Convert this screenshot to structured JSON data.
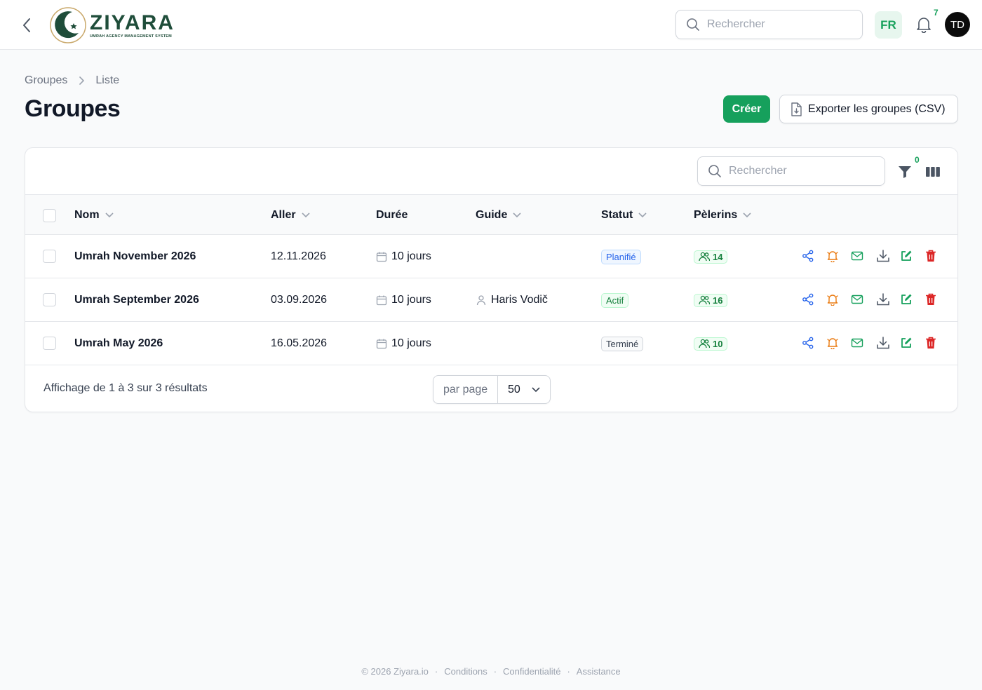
{
  "header": {
    "logo_word": "ZIYARA",
    "logo_tagline": "UMRAH AGENCY MANAGEMENT SYSTEM",
    "search_placeholder": "Rechercher",
    "language": "FR",
    "notifications_count": "7",
    "avatar_initials": "TD"
  },
  "breadcrumb": {
    "items": [
      "Groupes",
      "Liste"
    ]
  },
  "page": {
    "title": "Groupes",
    "create_label": "Créer",
    "export_label": "Exporter les groupes (CSV)"
  },
  "table": {
    "search_placeholder": "Rechercher",
    "filter_count": "0",
    "columns": [
      "Nom",
      "Aller",
      "Durée",
      "Guide",
      "Statut",
      "Pèlerins"
    ],
    "rows": [
      {
        "name": "Umrah November 2026",
        "departure": "12.11.2026",
        "duration": "10 jours",
        "guide": "",
        "status": "Planifié",
        "status_type": "planned",
        "pilgrims": "14"
      },
      {
        "name": "Umrah September 2026",
        "departure": "03.09.2026",
        "duration": "10 jours",
        "guide": "Haris Vodič",
        "status": "Actif",
        "status_type": "active",
        "pilgrims": "16"
      },
      {
        "name": "Umrah May 2026",
        "departure": "16.05.2026",
        "duration": "10 jours",
        "guide": "",
        "status": "Terminé",
        "status_type": "done",
        "pilgrims": "10"
      }
    ],
    "results_text": "Affichage de 1 à 3 sur 3 résultats",
    "per_page_label": "par page",
    "per_page_value": "50"
  },
  "footer": {
    "copyright": "© 2026 Ziyara.io",
    "links": [
      "Conditions",
      "Confidentialité",
      "Assistance"
    ]
  },
  "colors": {
    "brand": "#1f4d3a",
    "accent_green": "#16a05c",
    "share": "#2563eb",
    "bell_action": "#ea7a10",
    "mail": "#16a05c",
    "download": "#4b5563",
    "edit": "#16a05c",
    "delete": "#dc2626"
  }
}
